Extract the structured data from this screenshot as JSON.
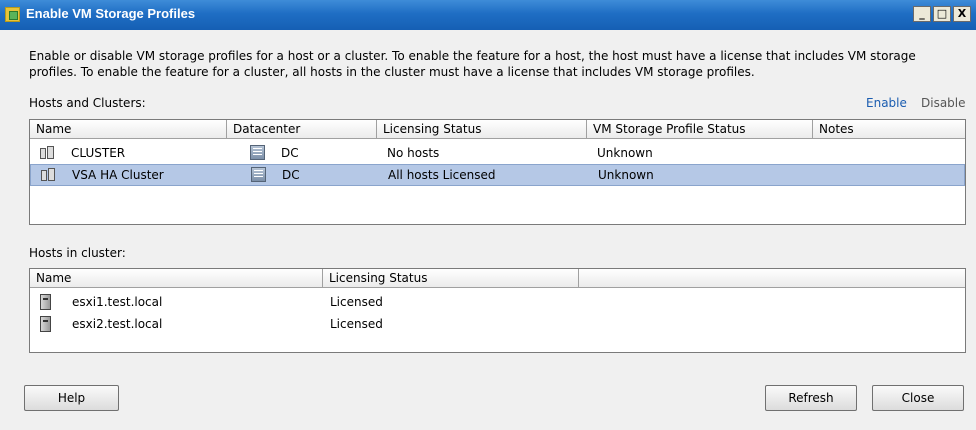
{
  "window": {
    "title": "Enable VM Storage Profiles",
    "minimize": "_",
    "maximize": "□",
    "close": "X"
  },
  "description": "Enable or disable VM storage profiles for a host or a cluster. To enable the feature for a host, the host must have a license that includes VM storage profiles. To enable the feature for a cluster, all hosts in the cluster must have a license that includes VM storage profiles.",
  "hosts_and_clusters": {
    "label": "Hosts and Clusters:",
    "enable_link": "Enable",
    "disable_link": "Disable",
    "columns": [
      "Name",
      "Datacenter",
      "Licensing Status",
      "VM Storage Profile Status",
      "Notes"
    ],
    "rows": [
      {
        "icon": "cluster-icon",
        "name": "CLUSTER",
        "datacenter_icon": "datacenter-icon",
        "datacenter": "DC",
        "licensing": "No hosts",
        "profile_status": "Unknown",
        "notes": "",
        "selected": false
      },
      {
        "icon": "cluster-icon",
        "name": "VSA HA Cluster",
        "datacenter_icon": "datacenter-icon",
        "datacenter": "DC",
        "licensing": "All hosts Licensed",
        "profile_status": "Unknown",
        "notes": "",
        "selected": true
      }
    ]
  },
  "hosts_in_cluster": {
    "label": "Hosts in cluster:",
    "columns": [
      "Name",
      "Licensing Status",
      ""
    ],
    "rows": [
      {
        "icon": "host-icon",
        "name": "esxi1.test.local",
        "licensing": "Licensed"
      },
      {
        "icon": "host-icon",
        "name": "esxi2.test.local",
        "licensing": "Licensed"
      }
    ]
  },
  "buttons": {
    "help": "Help",
    "refresh": "Refresh",
    "close": "Close"
  },
  "colors": {
    "titlebar": "#1f6ec4",
    "selection": "#b5c8e6",
    "link": "#1a5cb0"
  }
}
